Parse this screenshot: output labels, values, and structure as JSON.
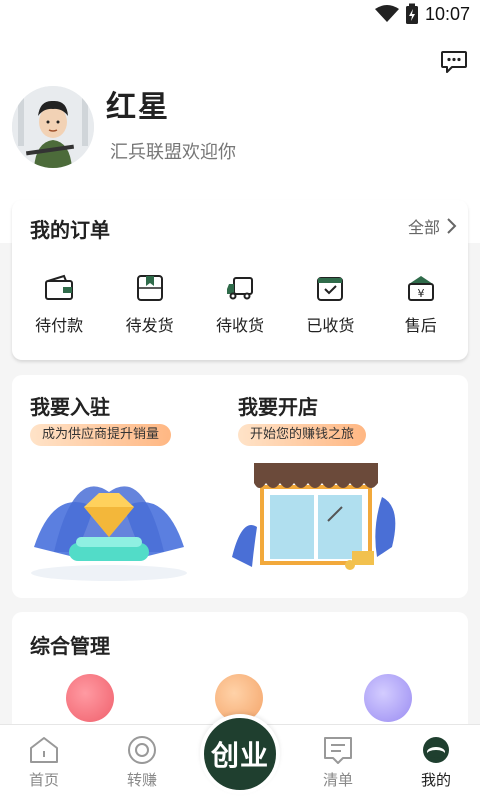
{
  "status": {
    "time": "10:07"
  },
  "profile": {
    "name": "红星",
    "welcome": "汇兵联盟欢迎你"
  },
  "orders": {
    "title": "我的订单",
    "all_label": "全部",
    "items": [
      {
        "label": "待付款",
        "icon": "wallet-icon"
      },
      {
        "label": "待发货",
        "icon": "package-icon"
      },
      {
        "label": "待收货",
        "icon": "truck-icon"
      },
      {
        "label": "已收货",
        "icon": "received-box-icon"
      },
      {
        "label": "售后",
        "icon": "after-sales-icon"
      }
    ]
  },
  "settle": {
    "supplier": {
      "title": "我要入驻",
      "pill": "成为供应商提升销量"
    },
    "store": {
      "title": "我要开店",
      "pill": "开始您的赚钱之旅"
    }
  },
  "manage": {
    "title": "综合管理"
  },
  "tabbar": {
    "items": [
      {
        "label": "首页",
        "icon": "home-icon"
      },
      {
        "label": "转赚",
        "icon": "share-earn-icon"
      },
      {
        "label": "清单",
        "icon": "list-icon"
      },
      {
        "label": "我的",
        "icon": "profile-icon"
      }
    ],
    "center_label": "创业",
    "active": "我的"
  },
  "colors": {
    "accent": "#1f3f2f",
    "pill_start": "#ffe3c8",
    "pill_end": "#ffb783"
  }
}
